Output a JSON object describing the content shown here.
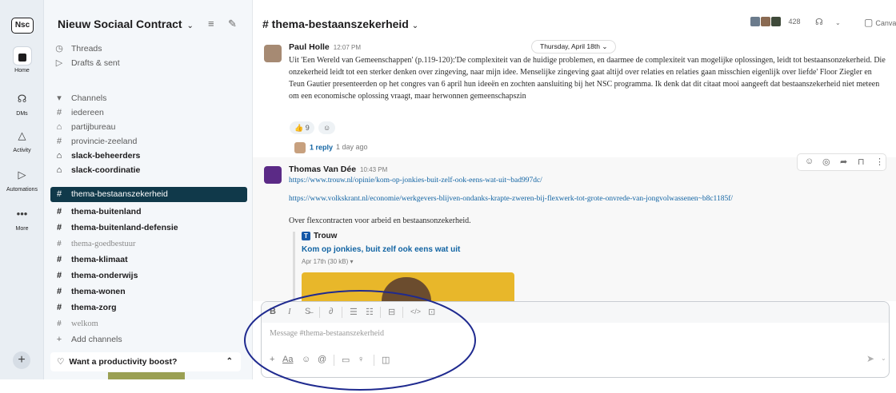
{
  "rail": {
    "workspace_badge": "Nsc",
    "items": [
      {
        "label": "Home",
        "icon": "home-icon"
      },
      {
        "label": "DMs",
        "icon": "dms-icon"
      },
      {
        "label": "Activity",
        "icon": "bell-icon"
      },
      {
        "label": "Automations",
        "icon": "automations-icon"
      },
      {
        "label": "More",
        "icon": "more-icon"
      }
    ],
    "add_glyph": "+"
  },
  "sidebar": {
    "workspace_name": "Nieuw Sociaal Contract",
    "workspace_chevron": "⌄",
    "top_items": [
      {
        "label": "Threads"
      },
      {
        "label": "Drafts & sent"
      }
    ],
    "channels_header": "Channels",
    "channels": [
      {
        "label": "iedereen",
        "prefix": "#"
      },
      {
        "label": "partijbureau",
        "prefix": "🔒"
      },
      {
        "label": "provincie-zeeland",
        "prefix": "#"
      },
      {
        "label": "slack-beheerders",
        "prefix": "🔒"
      },
      {
        "label": "slack-coordinatie",
        "prefix": "🔒"
      },
      {
        "label": "thema-bestaanszekerheid",
        "prefix": "#"
      },
      {
        "label": "thema-buitenland",
        "prefix": "#"
      },
      {
        "label": "thema-buitenland-defensie",
        "prefix": "#"
      },
      {
        "label": "thema-goedbestuur",
        "prefix": "#"
      },
      {
        "label": "thema-klimaat",
        "prefix": "#"
      },
      {
        "label": "thema-onderwijs",
        "prefix": "#"
      },
      {
        "label": "thema-wonen",
        "prefix": "#"
      },
      {
        "label": "thema-zorg",
        "prefix": "#"
      },
      {
        "label": "welkom",
        "prefix": "#"
      }
    ],
    "add_channels": "Add channels",
    "promo": "Want a productivity boost?"
  },
  "header": {
    "channel_title": "# thema-bestaanszekerheid",
    "chevron": "⌄",
    "member_count": "428",
    "canvas_label": "Canvas"
  },
  "messages": [
    {
      "author": "Paul Holle",
      "time": "12:07 PM",
      "text": "Uit 'Een Wereld van Gemeenschappen' (p.119-120):'De complexiteit van de huidige problemen, en daarmee de complexiteit van mogelijke oplossingen, leidt tot bestaansonzekerheid. Die onzekerheid leidt tot een sterker denken over zingeving, naar mijn idee. Menselijke zingeving gaat altijd over relaties en relaties gaan misschien eigenlijk over liefde' Floor Ziegler en Teun Gautier presenteerden op het congres van 6 april hun ideeën en zochten aansluiting bij het NSC programma. Ik denk dat dit citaat mooi aangeeft dat bestaanszekerheid niet meteen om een economische oplossing vraagt, maar herwonnen gemeenschapszin",
      "reaction_emoji": "👍",
      "reaction_count": "9",
      "reply_count": "1 reply",
      "reply_ago": "1 day ago"
    },
    {
      "author": "Thomas Van Dée",
      "time": "10:43 PM",
      "link1": "https://www.trouw.nl/opinie/kom-op-jonkies-buit-zelf-ook-eens-wat-uit~bad997dc/",
      "link2": "https://www.volkskrant.nl/economie/werkgevers-blijven-ondanks-krapte-zweren-bij-flexwerk-tot-grote-onvrede-van-jongvolwassenen~b8c1185f/",
      "text": "Over flexcontracten voor arbeid en bestaansonzekerheid.",
      "unfurl_source": "Trouw",
      "unfurl_title": "Kom op jonkies, buit zelf ook eens wat uit",
      "unfurl_meta": "Apr 17th (30 kB)"
    }
  ],
  "date_divider": "Thursday, April 18th",
  "composer": {
    "placeholder": "Message #thema-bestaanszekerheid",
    "aa_label": "Aa"
  },
  "colors": {
    "selected_channel_bg": "#10394a",
    "link": "#1264a3",
    "annotation": "#1f2a8f"
  }
}
